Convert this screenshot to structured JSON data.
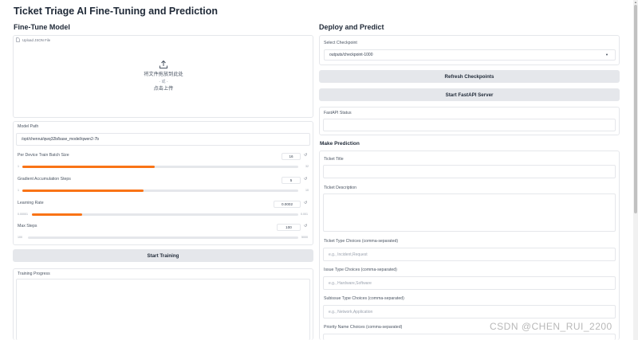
{
  "app": {
    "title": "Ticket Triage AI Fine-Tuning and Prediction"
  },
  "left": {
    "title": "Fine-Tune Model",
    "upload": {
      "label": "Upload JSON File",
      "drop_text": "将文件拖放到此处",
      "or_text": "- 或 -",
      "click_text": "点击上传"
    },
    "model_path": {
      "label": "Model Path",
      "value": "/opt/chenrui/qwq32b/base_model/qwen2-7b"
    },
    "sliders": [
      {
        "label": "Per Device Train Batch Size",
        "value": "16",
        "min": "1",
        "max": "32",
        "fraction": 0.48
      },
      {
        "label": "Gradient Accumulation Steps",
        "value": "5",
        "min": "1",
        "max": "10",
        "fraction": 0.44
      },
      {
        "label": "Learning Rate",
        "value": "0.0002",
        "min": "0.00001",
        "max": "0.001",
        "fraction": 0.19
      },
      {
        "label": "Max Steps",
        "value": "100",
        "min": "100",
        "max": "5000",
        "fraction": 0.0
      }
    ],
    "start_training_label": "Start Training",
    "training_progress_label": "Training Progress"
  },
  "right": {
    "title": "Deploy and Predict",
    "checkpoint": {
      "label": "Select Checkpoint",
      "value": "outputs/checkpoint-1000"
    },
    "refresh_label": "Refresh Checkpoints",
    "start_server_label": "Start FastAPI Server",
    "status_label": "FastAPI Status",
    "prediction_title": "Make Prediction",
    "fields": [
      {
        "label": "Ticket Title",
        "placeholder": ""
      },
      {
        "label": "Ticket Description",
        "placeholder": ""
      },
      {
        "label": "Ticket Type Choices (comma-separated)",
        "placeholder": "e.g., Incident,Request"
      },
      {
        "label": "Issue Type Choices (comma-separated)",
        "placeholder": "e.g., Hardware,Software"
      },
      {
        "label": "Subissue Type Choices (comma-separated)",
        "placeholder": "e.g., Network,Application"
      },
      {
        "label": "Priority Name Choices (comma-separated)",
        "placeholder": ""
      }
    ]
  },
  "watermark": "CSDN @CHEN_RUI_2200",
  "colors": {
    "accent": "#f97316",
    "button_bg": "#e5e7eb",
    "border": "#e5e7eb"
  },
  "icons": {
    "upload": "upload-icon",
    "file": "file-icon",
    "reset": "reset-icon",
    "dropdown": "chevron-down-icon"
  }
}
